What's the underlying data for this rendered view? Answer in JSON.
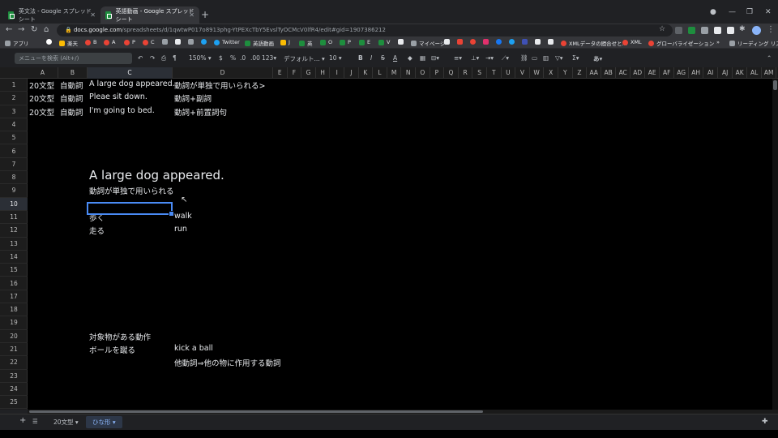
{
  "browser": {
    "tabs": [
      {
        "title": "英文法 - Google スプレッドシート",
        "active": false
      },
      {
        "title": "英語動画 - Google スプレッドシート",
        "active": true
      }
    ],
    "url_domain": "docs.google.com",
    "url_path": "/spreadsheets/d/1qwtwP017o8913phg-YtPEXcTbY5EvslTyOCMcV0lfR4/edit#gid=1907386212",
    "bookmarks": [
      "アプリ",
      "楽天",
      "B",
      "A",
      "P",
      "C",
      "Twitter",
      "英語動画",
      "J",
      "英",
      "O",
      "P",
      "E",
      "V",
      "マイページ",
      "XMLデータの間合せと...",
      "XML",
      "グローバライゼーション"
    ],
    "reading_list": "リーディング リスト"
  },
  "toolbar": {
    "menu_search_placeholder": "メニューを検索 (Alt+/)",
    "zoom": "150%",
    "currency": "$",
    "percent": "%",
    "decimal_less": ".0",
    "decimal_more": ".00",
    "number_format": "123",
    "font": "デフォルト...",
    "font_size": "10",
    "bold": "B",
    "italic": "I",
    "strike": "S",
    "text_color": "A",
    "input_tool": "あ"
  },
  "columns": [
    "A",
    "B",
    "C",
    "D",
    "E",
    "F",
    "G",
    "H",
    "I",
    "J",
    "K",
    "L",
    "M",
    "N",
    "O",
    "P",
    "Q",
    "R",
    "S",
    "T",
    "U",
    "V",
    "W",
    "X",
    "Y",
    "Z",
    "AA",
    "AB",
    "AC",
    "AD",
    "AE",
    "AF",
    "AG",
    "AH",
    "AI",
    "AJ",
    "AK",
    "AL",
    "AM"
  ],
  "rows": [
    "1",
    "2",
    "3",
    "4",
    "5",
    "6",
    "7",
    "8",
    "9",
    "10",
    "11",
    "12",
    "13",
    "14",
    "15",
    "16",
    "17",
    "18",
    "19",
    "20",
    "21",
    "22",
    "23",
    "24",
    "25"
  ],
  "cells": {
    "A1": "20文型",
    "B1": "自動詞",
    "C1": "A large dog appeared.",
    "D1": "動詞が単独で用いられる>",
    "A2": "20文型",
    "B2": "自動詞",
    "C2": "Pleae sit down.",
    "D2": "動詞+副詞",
    "A3": "20文型",
    "B3": "自動詞",
    "C3": "I'm going to bed.",
    "D3": "動詞+前置詞句",
    "C8": "A large dog appeared.",
    "C9": "動詞が単独で用いられる",
    "C11": "歩く",
    "D11": "walk",
    "C12": "走る",
    "D12": "run",
    "C20": "対象物がある動作",
    "C21": "ボールを蹴る",
    "D21": "kick a ball",
    "D22": "他動詞⇒他の物に作用する動詞"
  },
  "selected_cell": "C10",
  "sheets": [
    {
      "name": "20文型",
      "active": false
    },
    {
      "name": "ひな形",
      "active": true
    }
  ]
}
